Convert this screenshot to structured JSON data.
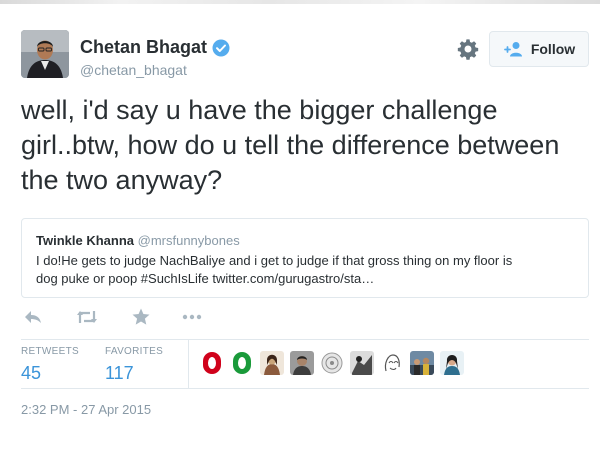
{
  "author": {
    "name": "Chetan Bhagat",
    "handle": "@chetan_bhagat",
    "verified": true,
    "avatar_icon": "profile-photo"
  },
  "header": {
    "settings_icon": "gear-icon",
    "follow_label": "Follow",
    "follow_icon": "add-user-icon"
  },
  "tweet": {
    "text": "well, i'd say u have the bigger challenge girl..btw, how do u tell the difference between the two anyway?"
  },
  "quoted_tweet": {
    "name": "Twinkle Khanna",
    "handle": "@mrsfunnybones",
    "text": "I do!He gets to judge NachBaliye and i get  to judge if that gross thing on my floor is dog puke or poop #SuchIsLife twitter.com/gurugastro/sta…"
  },
  "actions": [
    {
      "name": "reply-icon"
    },
    {
      "name": "retweet-icon"
    },
    {
      "name": "favorite-icon"
    },
    {
      "name": "more-icon"
    }
  ],
  "stats": {
    "retweets_label": "RETWEETS",
    "retweets_count": "45",
    "favorites_label": "FAVORITES",
    "favorites_count": "117"
  },
  "favoriters": [
    {
      "name": "favoriter-avatar-1",
      "color": "#d0021b"
    },
    {
      "name": "favoriter-avatar-2",
      "color": "#1a9a3a"
    },
    {
      "name": "favoriter-avatar-3",
      "color": "#c9a57a"
    },
    {
      "name": "favoriter-avatar-4",
      "color": "#6d6d6d"
    },
    {
      "name": "favoriter-avatar-5",
      "color": "#cfcfcf"
    },
    {
      "name": "favoriter-avatar-6",
      "color": "#4a4a4a"
    },
    {
      "name": "favoriter-avatar-7",
      "color": "#e8e8e8"
    },
    {
      "name": "favoriter-avatar-8",
      "color": "#3a4a5a"
    },
    {
      "name": "favoriter-avatar-9",
      "color": "#2f6f8f"
    }
  ],
  "timestamp": "2:32 PM - 27 Apr 2015",
  "colors": {
    "accent": "#3b94d9",
    "muted": "#8899a6",
    "text": "#292f33",
    "border": "#e1e8ed"
  }
}
